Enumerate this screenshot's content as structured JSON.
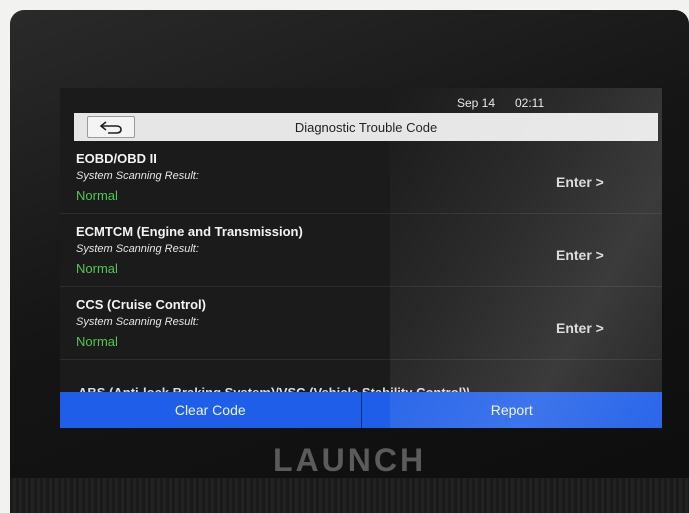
{
  "status_bar": {
    "date": "Sep 14",
    "time": "02:11"
  },
  "header": {
    "back_icon": "back-arrow-icon",
    "title": "Diagnostic Trouble Code"
  },
  "systems": [
    {
      "name": "EOBD/OBD II",
      "result_label": "System Scanning Result:",
      "result": "Normal",
      "action": "Enter >"
    },
    {
      "name": "ECMTCM (Engine and Transmission)",
      "result_label": "System Scanning Result:",
      "result": "Normal",
      "action": "Enter >"
    },
    {
      "name": "CCS (Cruise Control)",
      "result_label": "System Scanning Result:",
      "result": "Normal",
      "action": "Enter >"
    }
  ],
  "partial_item": {
    "name": "ABS (Anti-lock Braking System)/VSC (Vehicle Stability Control)\\"
  },
  "buttons": {
    "clear_code": "Clear Code",
    "report": "Report"
  },
  "device": {
    "brand": "LAUNCH"
  },
  "colors": {
    "accent_button": "#1e5ee8",
    "status_normal": "#4fc94f",
    "title_bar": "#e6e6e6"
  }
}
